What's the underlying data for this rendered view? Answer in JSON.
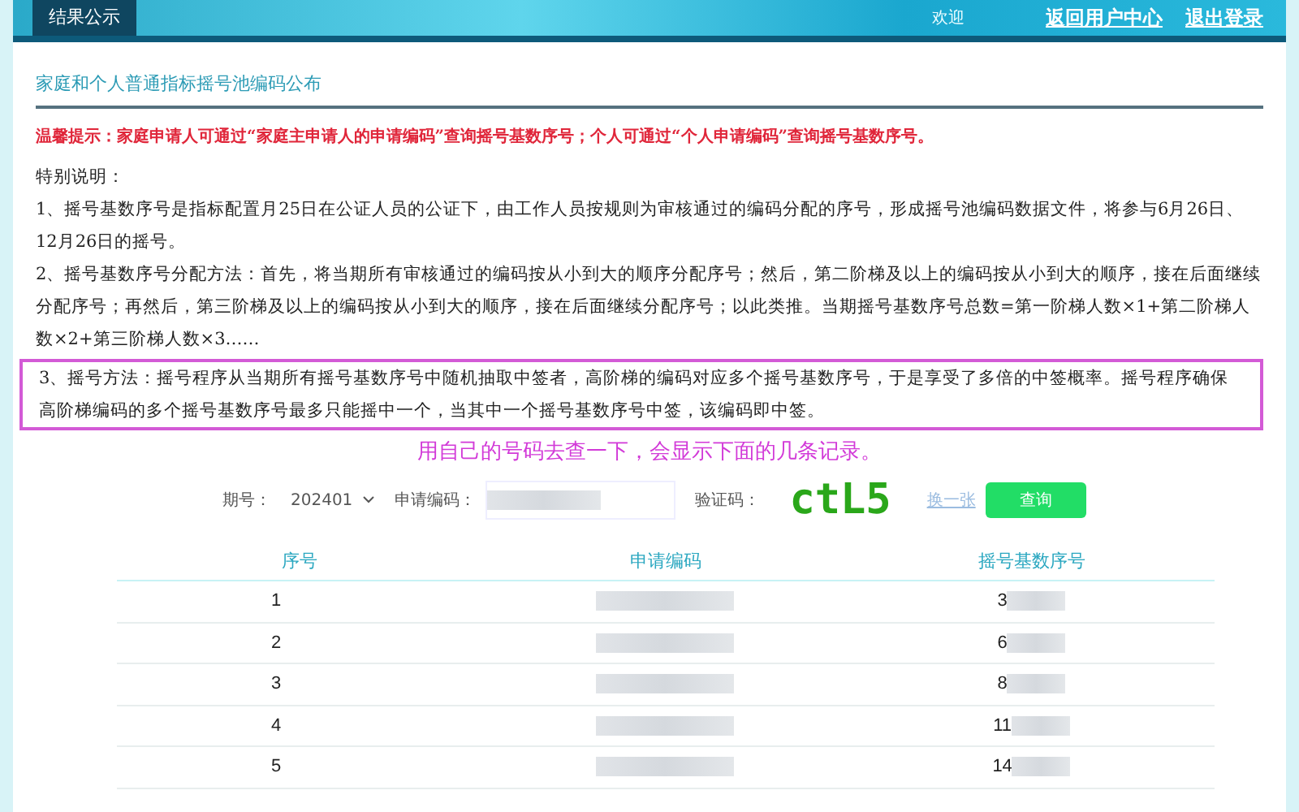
{
  "header": {
    "tab": "结果公示",
    "welcome": "欢迎",
    "links": [
      "返回用户中心",
      "退出登录"
    ]
  },
  "title": "家庭和个人普通指标摇号池编码公布",
  "notice": "温馨提示：家庭申请人可通过“家庭主申请人的申请编码”查询摇号基数序号；个人可通过“个人申请编码”查询摇号基数序号。",
  "special_heading": "特别说明：",
  "paragraphs": [
    {
      "text": "1、摇号基数序号是指标配置月25日在公证人员的公证下，由工作人员按规则为审核通过的编码分配的序号，形成摇号池编码数据文件，将参与6月26日、12月26日的摇号。",
      "highlighted": false
    },
    {
      "text": "2、摇号基数序号分配方法：首先，将当期所有审核通过的编码按从小到大的顺序分配序号；然后，第二阶梯及以上的编码按从小到大的顺序，接在后面继续分配序号；再然后，第三阶梯及以上的编码按从小到大的顺序，接在后面继续分配序号；以此类推。当期摇号基数序号总数=第一阶梯人数×1+第二阶梯人数×2+第三阶梯人数×3……",
      "highlighted": false
    },
    {
      "text": "3、摇号方法：摇号程序从当期所有摇号基数序号中随机抽取中签者，高阶梯的编码对应多个摇号基数序号，于是享受了多倍的中签概率。摇号程序确保高阶梯编码的多个摇号基数序号最多只能摇中一个，当其中一个摇号基数序号中签，该编码即中签。",
      "highlighted": true
    }
  ],
  "annotation": "用自己的号码去查一下，会显示下面的几条记录。",
  "form": {
    "period_label": "期号：",
    "period_value": "202401",
    "code_label": "申请编码：",
    "captcha_label": "验证码：",
    "captcha": "ctL5",
    "refresh_link": "换一张",
    "query_button": "查询"
  },
  "table": {
    "columns": [
      "序号",
      "申请编码",
      "摇号基数序号"
    ],
    "rows": [
      {
        "index": "1",
        "number_prefix": "3"
      },
      {
        "index": "2",
        "number_prefix": "6"
      },
      {
        "index": "3",
        "number_prefix": "8"
      },
      {
        "index": "4",
        "number_prefix": "11"
      },
      {
        "index": "5",
        "number_prefix": "14"
      }
    ]
  }
}
